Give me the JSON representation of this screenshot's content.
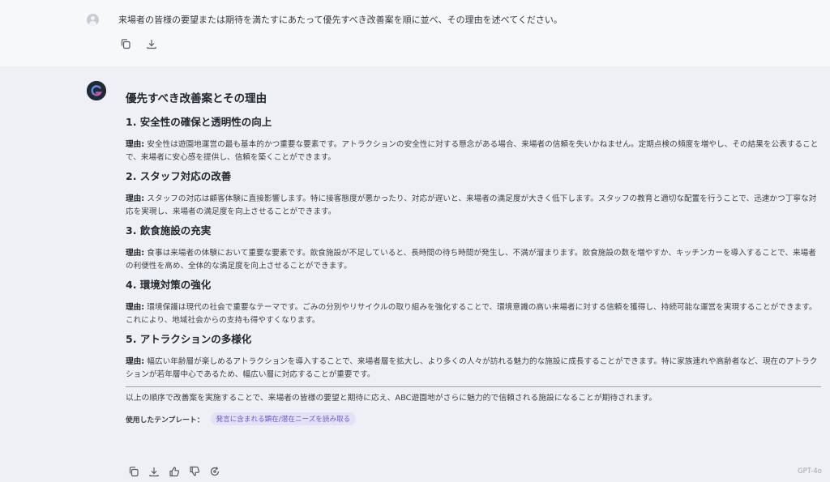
{
  "user": {
    "avatar": "user-avatar-icon",
    "message": "来場者の皆様の要望または期待を満たすにあたって優先すべき改善案を順に並べ、その理由を述べてください。",
    "actions": [
      "copy-icon",
      "download-icon"
    ]
  },
  "bot": {
    "avatar": "gpt-logo-icon",
    "title": "優先すべき改善案とその理由",
    "reason_label": "理由:",
    "sections": [
      {
        "heading": "1. 安全性の確保と透明性の向上",
        "reason": "安全性は遊園地運営の最も基本的かつ重要な要素です。アトラクションの安全性に対する懸念がある場合、来場者の信頼を失いかねません。定期点検の頻度を増やし、その結果を公表することで、来場者に安心感を提供し、信頼を築くことができます。"
      },
      {
        "heading": "2. スタッフ対応の改善",
        "reason": "スタッフの対応は顧客体験に直接影響します。特に接客態度が悪かったり、対応が遅いと、来場者の満足度が大きく低下します。スタッフの教育と適切な配置を行うことで、迅速かつ丁寧な対応を実現し、来場者の満足度を向上させることができます。"
      },
      {
        "heading": "3. 飲食施設の充実",
        "reason": "食事は来場者の体験において重要な要素です。飲食施設が不足していると、長時間の待ち時間が発生し、不満が溜まります。飲食施設の数を増やすか、キッチンカーを導入することで、来場者の利便性を高め、全体的な満足度を向上させることができます。"
      },
      {
        "heading": "4. 環境対策の強化",
        "reason": "環境保護は現代の社会で重要なテーマです。ごみの分別やリサイクルの取り組みを強化することで、環境意識の高い来場者に対する信頼を獲得し、持続可能な運営を実現することができます。これにより、地域社会からの支持も得やすくなります。"
      },
      {
        "heading": "5. アトラクションの多様化",
        "reason": "幅広い年齢層が楽しめるアトラクションを導入することで、来場者層を拡大し、より多くの人々が訪れる魅力的な施設に成長することができます。特に家族連れや高齢者など、現在のアトラクションが若年層中心であるため、幅広い層に対応することが重要です。"
      }
    ],
    "conclusion": "以上の順序で改善案を実施することで、来場者の皆様の要望と期待に応え、ABC遊園地がさらに魅力的で信頼される施設になることが期待されます。",
    "template_label": "使用したテンプレート：",
    "template_tag": "発言に含まれる顕在/潜在ニーズを読み取る",
    "actions": [
      "copy-icon",
      "download-icon",
      "thumbs-up-icon",
      "thumbs-down-icon",
      "regenerate-icon"
    ],
    "model": "GPT-4o"
  }
}
